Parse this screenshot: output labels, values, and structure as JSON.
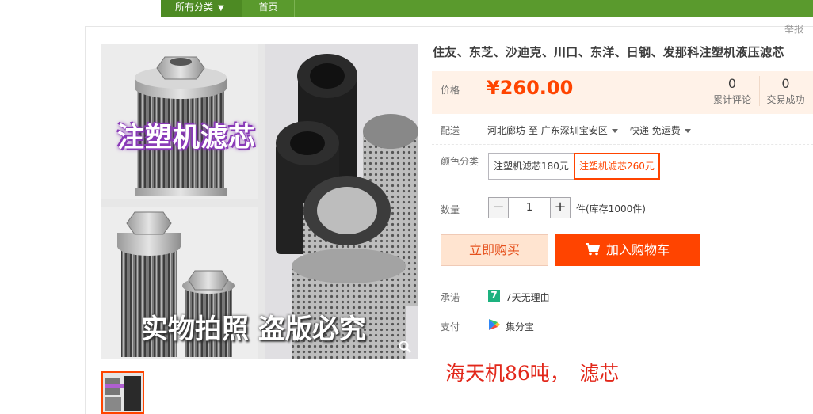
{
  "nav": {
    "categories_label": "所有分类",
    "categories_arrow": "▼",
    "home_label": "首页"
  },
  "report_label": "举报",
  "product": {
    "title": "住友、东芝、沙迪克、川口、东洋、日钢、发那科注塑机液压滤芯",
    "image_overlay_top": "注塑机滤芯",
    "image_overlay_bottom": "实物拍照 盗版必究"
  },
  "price": {
    "label": "价格",
    "value": "¥260.00"
  },
  "stats": [
    {
      "value": "0",
      "label": "累计评论"
    },
    {
      "value": "0",
      "label": "交易成功"
    }
  ],
  "shipping": {
    "label": "配送",
    "from": "河北廊坊",
    "to_word": "至",
    "to": "广东深圳宝安区",
    "method": "快递 免运费"
  },
  "color": {
    "label": "颜色分类",
    "options": [
      "注塑机滤芯180元",
      "注塑机滤芯260元"
    ],
    "selected_index": 1
  },
  "quantity": {
    "label": "数量",
    "minus": "−",
    "plus": "+",
    "value": "1",
    "unit_stock": "件(库存1000件)"
  },
  "buttons": {
    "buy_now": "立即购买",
    "add_cart": "加入购物车"
  },
  "promise": {
    "label": "承诺",
    "icon_text": "7",
    "text": "7天无理由"
  },
  "payment": {
    "label": "支付",
    "text": "集分宝"
  },
  "note": "海天机86吨，　滤芯",
  "colors": {
    "accent": "#ff4400",
    "nav_green": "#5a9a2d",
    "price_bg": "#fff2e8",
    "note_red": "#e2271a"
  }
}
